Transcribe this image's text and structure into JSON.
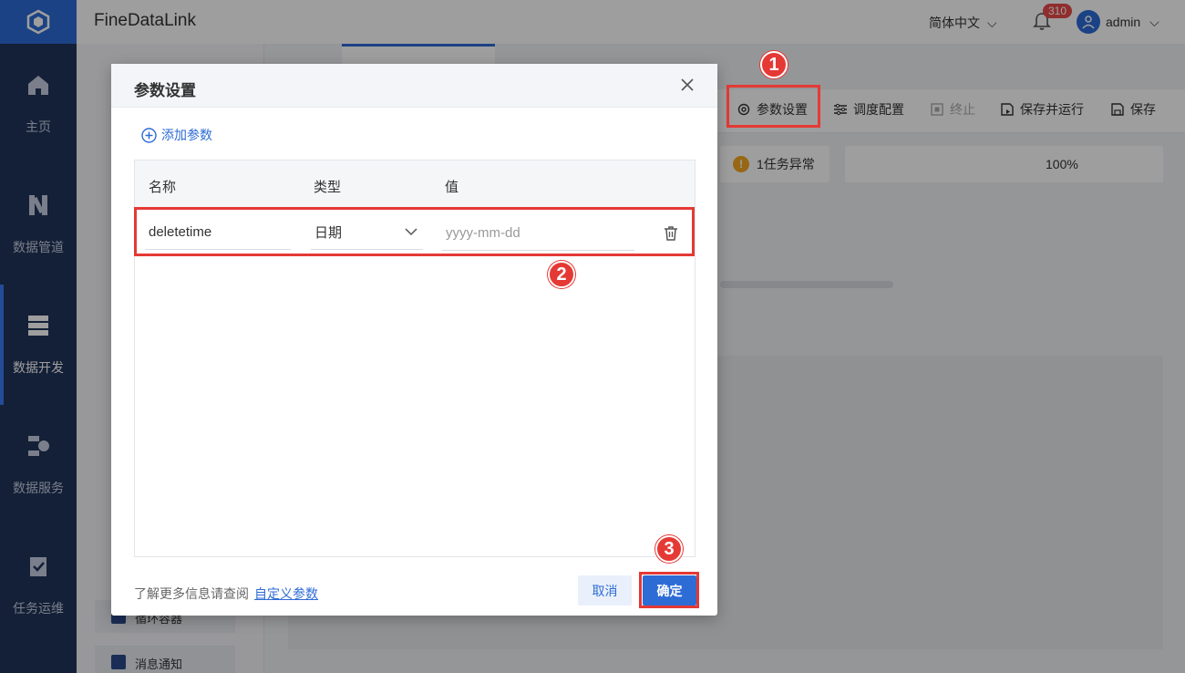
{
  "app": {
    "title": "FineDataLink"
  },
  "header": {
    "language": "简体中文",
    "notification_count": "310",
    "username": "admin"
  },
  "sidebar": {
    "items": [
      {
        "label": "主页",
        "icon": "home-icon"
      },
      {
        "label": "数据管道",
        "icon": "pipeline-icon"
      },
      {
        "label": "数据开发",
        "icon": "dev-icon",
        "active": true
      },
      {
        "label": "数据服务",
        "icon": "service-icon"
      },
      {
        "label": "任务运维",
        "icon": "ops-icon"
      }
    ]
  },
  "task_panel": {
    "items": [
      {
        "label": "循环容器"
      },
      {
        "label": "消息通知"
      }
    ]
  },
  "toolbar": {
    "param_settings": "参数设置",
    "schedule_config": "调度配置",
    "terminate": "终止",
    "save_and_run": "保存并运行",
    "save": "保存"
  },
  "canvas": {
    "warning": "1任务异常",
    "zoom": "100%"
  },
  "modal": {
    "title": "参数设置",
    "add_param": "添加参数",
    "columns": {
      "name": "名称",
      "type": "类型",
      "value": "值"
    },
    "row": {
      "name": "deletetime",
      "type": "日期",
      "value_placeholder": "yyyy-mm-dd"
    },
    "footer_text": "了解更多信息请查阅",
    "footer_link": "自定义参数",
    "cancel": "取消",
    "confirm": "确定"
  },
  "annotations": {
    "step1": "1",
    "step2": "2",
    "step3": "3"
  },
  "colors": {
    "accent": "#2d6bd5",
    "sidebar": "#21345a",
    "highlight": "#e53935"
  }
}
